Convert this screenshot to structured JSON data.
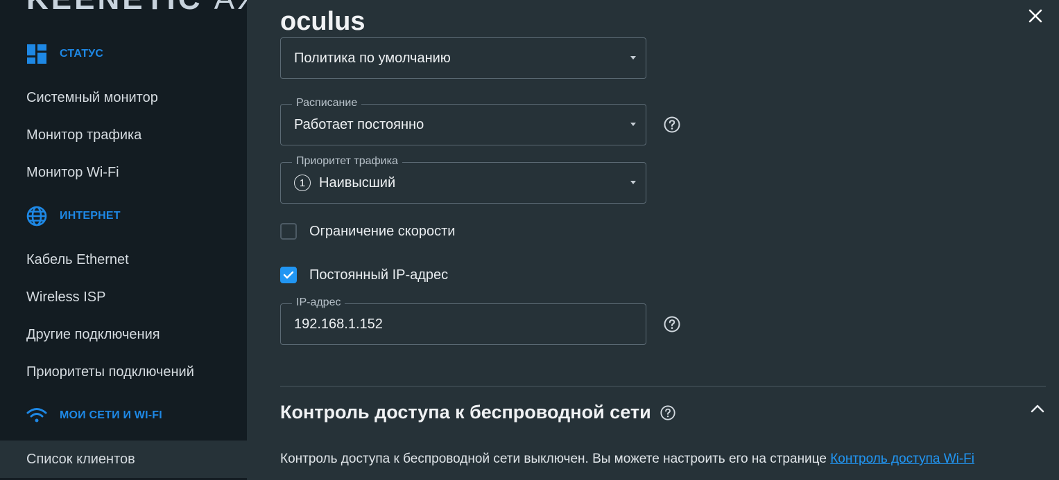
{
  "sidebar": {
    "brand": "KEENETIC",
    "brand_suffix": "AX",
    "sections": [
      {
        "label": "Статус",
        "icon": "dashboard-icon"
      },
      {
        "label": "Интернет",
        "icon": "globe-icon"
      },
      {
        "label": "Мои сети и Wi-Fi",
        "icon": "wifi-icon"
      }
    ],
    "status_items": [
      "Системный монитор",
      "Монитор трафика",
      "Монитор Wi-Fi"
    ],
    "internet_items": [
      "Кабель Ethernet",
      "Wireless ISP",
      "Другие подключения",
      "Приоритеты подключений"
    ],
    "network_items": [
      "Список клиентов"
    ]
  },
  "dialog": {
    "title": "oculus",
    "policy": {
      "value": "Политика по умолчанию"
    },
    "schedule": {
      "legend": "Расписание",
      "value": "Работает постоянно"
    },
    "priority": {
      "legend": "Приоритет трафика",
      "number": "1",
      "value": "Наивысший"
    },
    "speed_limit": {
      "label": "Ограничение скорости",
      "checked": false
    },
    "static_ip": {
      "label": "Постоянный IP-адрес",
      "checked": true
    },
    "ip_field": {
      "legend": "IP-адрес",
      "value": "192.168.1.152"
    },
    "access_control": {
      "title": "Контроль доступа к беспроводной сети",
      "text": "Контроль доступа к беспроводной сети выключен. Вы можете настроить его на странице ",
      "link": "Контроль доступа Wi-Fi"
    }
  },
  "colors": {
    "accent": "#2196f3",
    "sidebar_bg": "#131c22",
    "panel_bg": "#263238"
  }
}
